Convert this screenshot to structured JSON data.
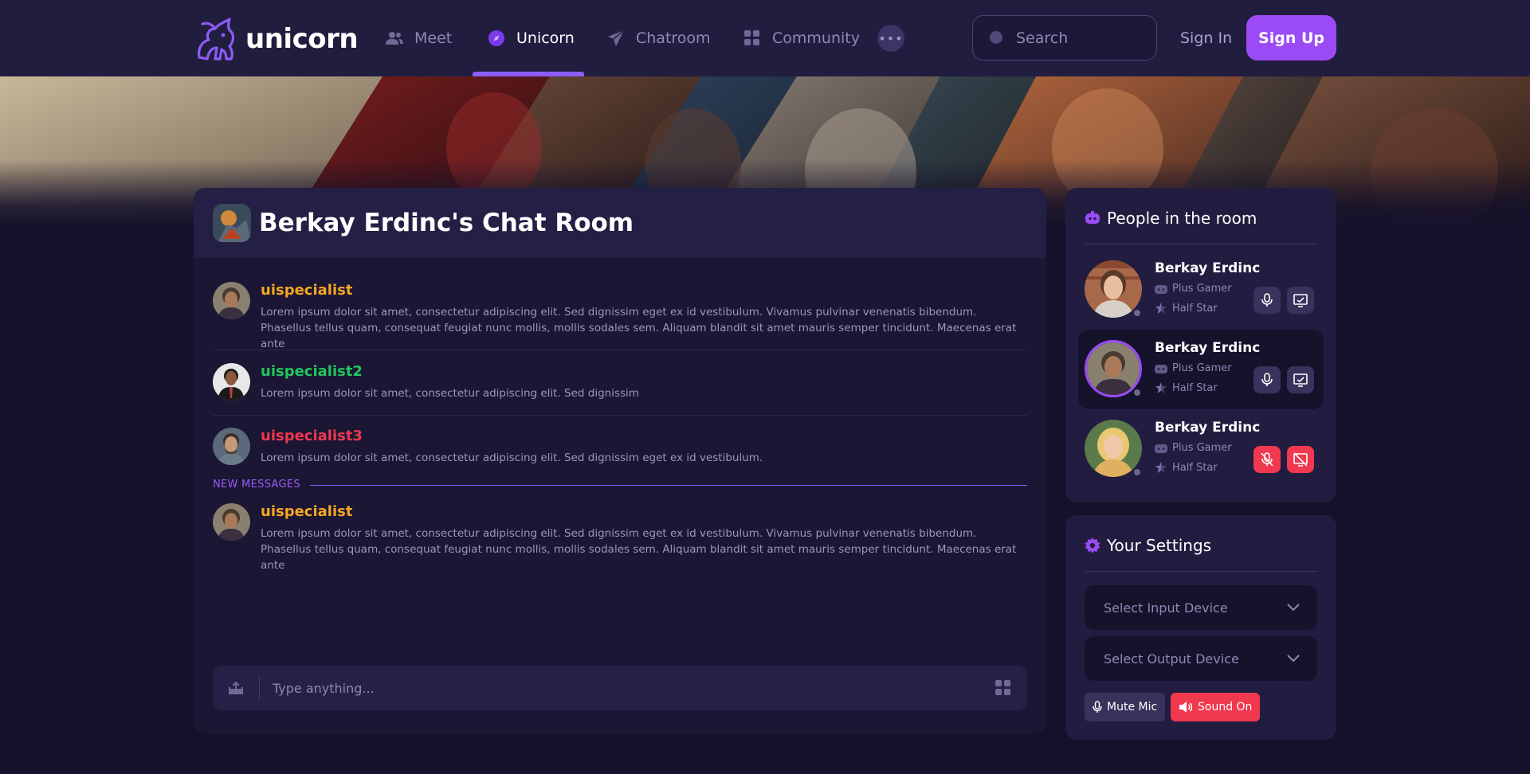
{
  "app": {
    "name": "unicorn"
  },
  "nav": {
    "items": [
      {
        "label": "Meet",
        "icon": "users-icon"
      },
      {
        "label": "Unicorn",
        "icon": "compass-icon",
        "active": true
      },
      {
        "label": "Chatroom",
        "icon": "paper-plane-icon"
      },
      {
        "label": "Community",
        "icon": "grid-icon"
      }
    ],
    "more_label": "•••",
    "search_placeholder": "Search",
    "signin_label": "Sign In",
    "signup_label": "Sign Up"
  },
  "chat": {
    "title": "Berkay Erdinc's Chat Room",
    "messages": [
      {
        "user": "uispecialist",
        "color": "#f5a623",
        "text": "Lorem ipsum dolor sit amet, consectetur adipiscing elit. Sed dignissim eget ex id vestibulum. Vivamus pulvinar venenatis bibendum. Phasellus tellus quam, consequat feugiat nunc mollis, mollis sodales sem. Aliquam blandit sit amet mauris semper tincidunt. Maecenas erat ante"
      },
      {
        "user": "uispecialist2",
        "color": "#22c55e",
        "text": "Lorem ipsum dolor sit amet, consectetur adipiscing elit. Sed dignissim"
      },
      {
        "user": "uispecialist3",
        "color": "#f0384f",
        "text": "Lorem ipsum dolor sit amet, consectetur adipiscing elit. Sed dignissim eget ex id vestibulum."
      },
      {
        "user": "uispecialist",
        "color": "#f5a623",
        "text": "Lorem ipsum dolor sit amet, consectetur adipiscing elit. Sed dignissim eget ex id vestibulum. Vivamus pulvinar venenatis bibendum. Phasellus tellus quam, consequat feugiat nunc mollis, mollis sodales sem. Aliquam blandit sit amet mauris semper tincidunt. Maecenas erat ante"
      }
    ],
    "new_messages_label": "NEW MESSAGES",
    "composer_placeholder": "Type anything..."
  },
  "people": {
    "title": "People in the room",
    "members": [
      {
        "name": "Berkay Erdinc",
        "tier": "Plus Gamer",
        "rank": "Half Star",
        "mic_muted": false,
        "active": false
      },
      {
        "name": "Berkay Erdinc",
        "tier": "Plus Gamer",
        "rank": "Half Star",
        "mic_muted": false,
        "active": true
      },
      {
        "name": "Berkay Erdinc",
        "tier": "Plus Gamer",
        "rank": "Half Star",
        "mic_muted": true,
        "active": false
      }
    ]
  },
  "settings": {
    "title": "Your Settings",
    "input_device_placeholder": "Select Input Device",
    "output_device_placeholder": "Select Output Device",
    "mute_mic_label": "Mute Mic",
    "sound_on_label": "Sound On"
  },
  "colors": {
    "accent": "#9a4bf5",
    "danger": "#f0384f",
    "background": "#14112b",
    "panel": "#221d40"
  }
}
